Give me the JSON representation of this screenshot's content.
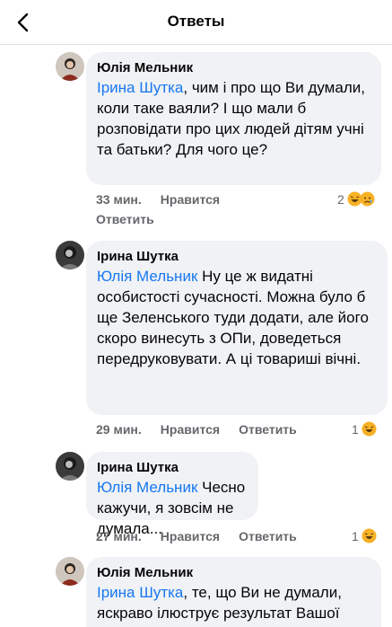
{
  "header": {
    "title": "Ответы"
  },
  "comments": [
    {
      "author": "Юлія Мельник",
      "mention": "Ірина Шутка",
      "text": ", чим і про що Ви думали, коли таке ваяли? І що мали б розповідати про цих людей дітям учні та батьки? Для чого це?",
      "time": "33 мин.",
      "like_label": "Нравится",
      "reply_label": "Ответить",
      "reaction_count": "2",
      "reaction_icons": [
        "haha-icon",
        "sad-icon"
      ]
    },
    {
      "author": "Ірина Шутка",
      "mention": "Юлія Мельник",
      "text": " Ну це ж видатні особистості сучасності. Можна було б ще Зеленського туди додати, але його скоро винесуть з ОПи, доведеться передруковувати. А ці товариші вічні.",
      "time": "29 мин.",
      "like_label": "Нравится",
      "reply_label": "Ответить",
      "reaction_count": "1",
      "reaction_icons": [
        "haha-icon"
      ]
    },
    {
      "author": "Ірина Шутка",
      "mention": "Юлія Мельник",
      "text": " Чесно кажучи, я зовсім не думала...",
      "time": "27 мин.",
      "like_label": "Нравится",
      "reply_label": "Ответить",
      "reaction_count": "1",
      "reaction_icons": [
        "haha-icon"
      ]
    },
    {
      "author": "Юлія Мельник",
      "mention": "Ірина Шутка",
      "text": ", те, що Ви не думали, яскраво ілюструє результат Вашої"
    }
  ],
  "colors": {
    "link": "#1877f2",
    "bubble": "#f0f2f5",
    "meta": "#65676b"
  }
}
